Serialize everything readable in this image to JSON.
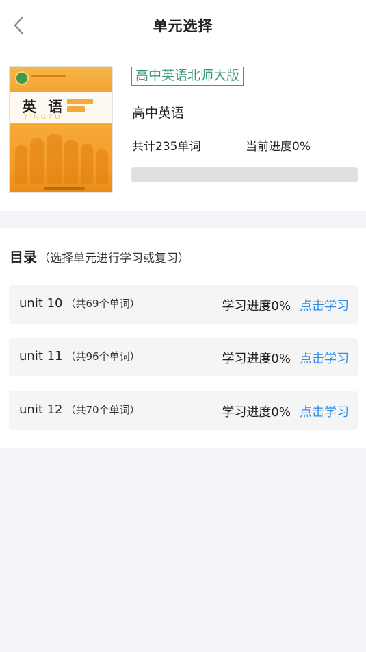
{
  "header": {
    "title": "单元选择",
    "back_icon": "chevron-left-icon"
  },
  "book": {
    "cover": {
      "title": "英 语",
      "pinyin": "YINGYU"
    },
    "name": "高中英语北师大版",
    "subject": "高中英语",
    "word_total": "共计235单词",
    "progress_text": "当前进度0%",
    "progress_value": 0
  },
  "directory": {
    "title": "目录",
    "hint": "（选择单元进行学习或复习）",
    "units": [
      {
        "name": "unit 10",
        "count": "（共69个单词）",
        "progress": "学习进度0%",
        "action": "点击学习"
      },
      {
        "name": "unit 11",
        "count": "（共96个单词）",
        "progress": "学习进度0%",
        "action": "点击学习"
      },
      {
        "name": "unit 12",
        "count": "（共70个单词）",
        "progress": "学习进度0%",
        "action": "点击学习"
      }
    ]
  },
  "colors": {
    "accent_green": "#3f9b7b",
    "link_blue": "#2f8fe6",
    "background": "#f3f4f8"
  }
}
